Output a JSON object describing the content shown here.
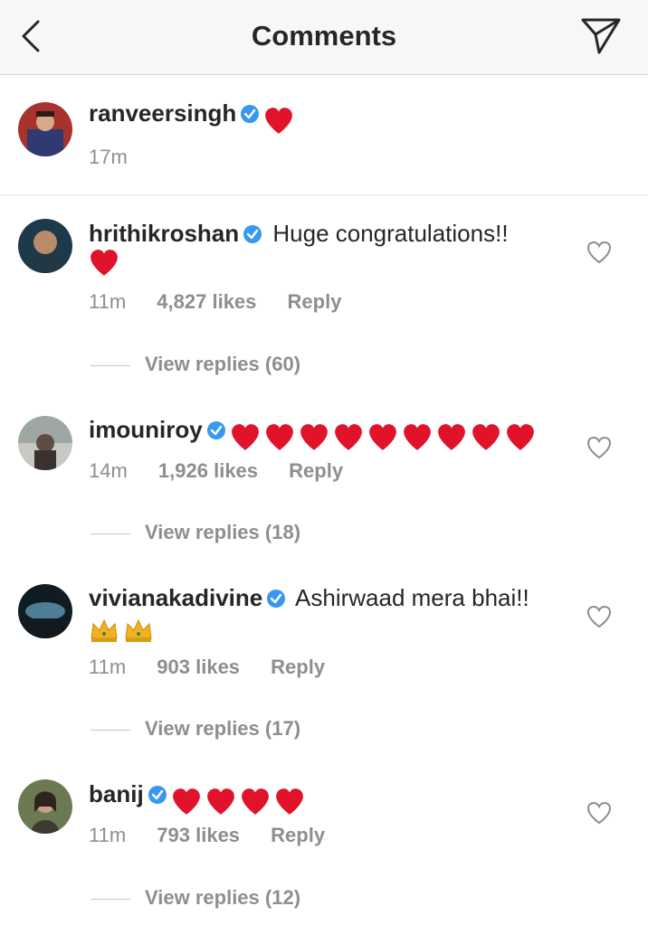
{
  "header": {
    "title": "Comments",
    "back_icon": "chevron-left-icon",
    "send_icon": "paper-plane-icon"
  },
  "caption": {
    "username": "ranveersingh",
    "verified": true,
    "time": "17m",
    "emoji": [
      "red-heart"
    ]
  },
  "comments": [
    {
      "username": "hrithikroshan",
      "text": "Huge congratulations!!",
      "emoji_line2": [
        "red-heart"
      ],
      "time": "11m",
      "likes": "4,827 likes",
      "reply_label": "Reply",
      "view_replies": "View replies (60)"
    },
    {
      "username": "imouniroy",
      "text": "",
      "emoji_inline": [
        "red-heart",
        "red-heart",
        "red-heart",
        "red-heart",
        "red-heart",
        "red-heart",
        "red-heart",
        "red-heart",
        "red-heart"
      ],
      "time": "14m",
      "likes": "1,926 likes",
      "reply_label": "Reply",
      "view_replies": "View replies (18)"
    },
    {
      "username": "vivianakadivine",
      "text": "Ashirwaad mera bhai!!",
      "emoji_line2": [
        "crown",
        "crown"
      ],
      "time": "11m",
      "likes": "903 likes",
      "reply_label": "Reply",
      "view_replies": "View replies (17)"
    },
    {
      "username": "banij",
      "text": "",
      "emoji_inline": [
        "red-heart",
        "red-heart",
        "red-heart",
        "red-heart"
      ],
      "time": "11m",
      "likes": "793 likes",
      "reply_label": "Reply",
      "view_replies": "View replies (12)"
    }
  ],
  "colors": {
    "verified_badge": "#3897f0",
    "heart": "#e0132b",
    "muted_text": "#8e8e8e",
    "header_bg": "#f7f7f7"
  }
}
